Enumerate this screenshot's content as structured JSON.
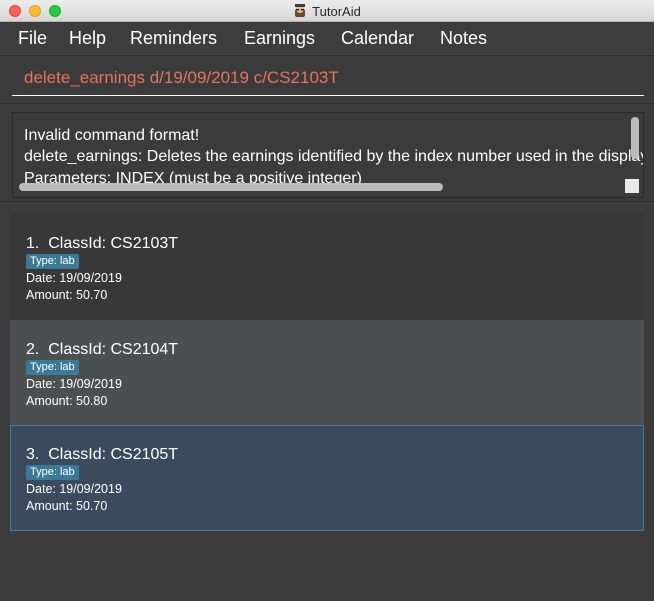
{
  "window": {
    "title": "TutorAid"
  },
  "menu": [
    {
      "label": "File"
    },
    {
      "label": "Help"
    },
    {
      "label": "Reminders"
    },
    {
      "label": "Earnings"
    },
    {
      "label": "Calendar"
    },
    {
      "label": "Notes"
    }
  ],
  "command": {
    "value": "delete_earnings d/19/09/2019 c/CS2103T"
  },
  "result": {
    "lines": [
      "Invalid command format!",
      "delete_earnings: Deletes the earnings identified by the index number used in the displayed earnings list.",
      "Parameters: INDEX (must be a positive integer)"
    ]
  },
  "earnings": [
    {
      "index": "1.",
      "class_id": "ClassId: CS2103T",
      "type": "Type: lab",
      "date": "Date: 19/09/2019",
      "amount": "Amount: 50.70"
    },
    {
      "index": "2.",
      "class_id": "ClassId: CS2104T",
      "type": "Type: lab",
      "date": "Date: 19/09/2019",
      "amount": "Amount: 50.80"
    },
    {
      "index": "3.",
      "class_id": "ClassId: CS2105T",
      "type": "Type: lab",
      "date": "Date: 19/09/2019",
      "amount": "Amount: 50.70"
    }
  ],
  "colors": {
    "background": "#3b3b3b",
    "command_text": "#e6735c",
    "tag": "#3a7a96",
    "selected_card": "#3b4a5d",
    "selected_border": "#3f7fa3"
  },
  "icons": {
    "app": "tutor-avatar-icon"
  }
}
